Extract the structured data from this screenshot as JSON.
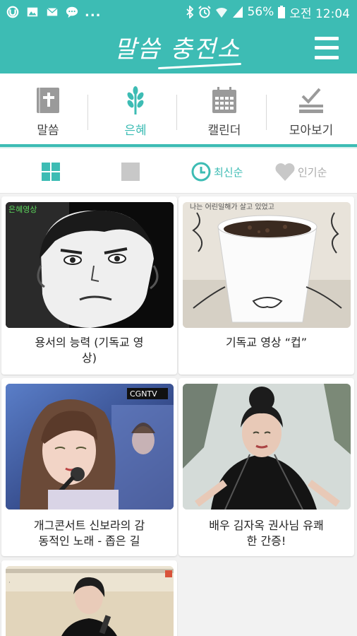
{
  "status_bar": {
    "battery": "56%",
    "time": "오전 12:04",
    "more": "..."
  },
  "app": {
    "logo": "말씀 충전소"
  },
  "categories": [
    {
      "label": "말씀",
      "icon": "bible-icon",
      "active": false
    },
    {
      "label": "은혜",
      "icon": "wheat-icon",
      "active": true
    },
    {
      "label": "캘린더",
      "icon": "calendar-icon",
      "active": false
    },
    {
      "label": "모아보기",
      "icon": "check-tray-icon",
      "active": false
    }
  ],
  "sort": {
    "recent": "최신순",
    "popular": "인기순"
  },
  "videos": [
    {
      "title": "용서의 능력 (기독교 영상)",
      "line1": "용서의 능력 (기독교 영",
      "line2": "상)",
      "overlay": "은혜영상"
    },
    {
      "title": "기독교 영상 “컵”",
      "line1": "기독교 영상 “컵”",
      "line2": "",
      "overlay": "나는 어린일해가 살고 있었고"
    },
    {
      "title": "개그콘서트 신보라의 감동적인 노래 - 좁은 길",
      "line1": "개그콘서트 신보라의 감",
      "line2": "동적인 노래 - 좁은 길",
      "overlay": "CGNTV"
    },
    {
      "title": "배우 김자옥 권사님 유쾌한 간증!",
      "line1": "배우 김자옥 권사님 유쾌",
      "line2": "한 간증!",
      "overlay": ""
    },
    {
      "title": "",
      "line1": "",
      "line2": "",
      "overlay": ""
    }
  ],
  "colors": {
    "accent": "#3dbcb4",
    "inactive": "#c8c8c8"
  }
}
